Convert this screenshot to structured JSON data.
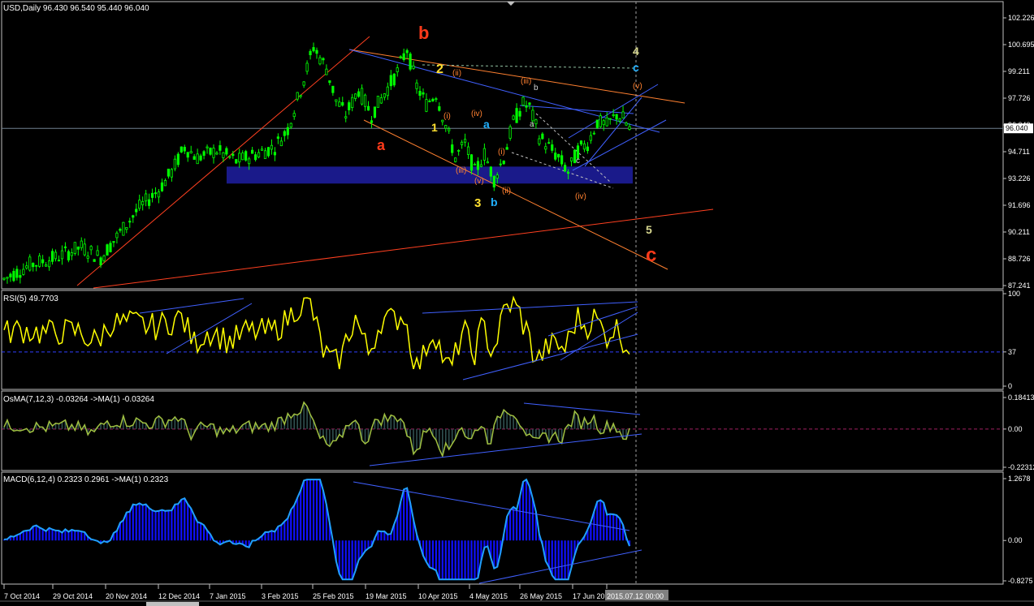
{
  "chart_data": [
    {
      "type": "candlestick",
      "symbol_label": "USD,Daily  96.430 96.540 95.440 96.040",
      "ylim": [
        87.241,
        102.226
      ],
      "y_ticks": [
        "102.226",
        "100.695",
        "99.211",
        "97.726",
        "96.040",
        "94.711",
        "93.226",
        "91.696",
        "90.211",
        "88.726",
        "87.241"
      ],
      "current_price": "96.040",
      "x_ticks": [
        "7 Oct 2014",
        "29 Oct 2014",
        "20 Nov 2014",
        "12 Dec 2014",
        "7 Jan 2015",
        "3 Feb 2015",
        "25 Feb 2015",
        "19 Mar 2015",
        "10 Apr 2015",
        "4 May 2015",
        "26 May 2015",
        "17 Jun 20",
        "2015.07.12 00:00"
      ],
      "wave_labels": [
        {
          "text": "b",
          "color": "#ff3a1a"
        },
        {
          "text": "a",
          "color": "#ff3a1a"
        },
        {
          "text": "c",
          "color": "#ff3a1a"
        },
        {
          "text": "2",
          "color": "#ffe030"
        },
        {
          "text": "1",
          "color": "#ffe030"
        },
        {
          "text": "3",
          "color": "#ffe030"
        },
        {
          "text": "4",
          "color": "#d8d890"
        },
        {
          "text": "5",
          "color": "#d8d890"
        },
        {
          "text": "c",
          "color": "#20b0ff"
        },
        {
          "text": "a",
          "color": "#20b0ff"
        },
        {
          "text": "b",
          "color": "#20b0ff"
        },
        {
          "text": "(ii)",
          "color": "#ff8030"
        },
        {
          "text": "(i)",
          "color": "#ff8030"
        },
        {
          "text": "(iv)",
          "color": "#ff8030"
        },
        {
          "text": "(iii)",
          "color": "#ff8030"
        },
        {
          "text": "(v)",
          "color": "#ff8030"
        },
        {
          "text": "(i)",
          "color": "#ff8030"
        },
        {
          "text": "(ii)",
          "color": "#ff8030"
        },
        {
          "text": "(iii)",
          "color": "#ff8030"
        },
        {
          "text": "(iv)",
          "color": "#ff8030"
        },
        {
          "text": "(v)",
          "color": "#ff8030"
        },
        {
          "text": "b",
          "color": "#d0d0d0"
        },
        {
          "text": "a",
          "color": "#d0d0d0"
        },
        {
          "text": "c",
          "color": "#d0d0d0"
        }
      ]
    },
    {
      "type": "line",
      "label": "RSI(5) 49.7703",
      "y_ticks": [
        "100",
        "37",
        "0"
      ],
      "ylim": [
        0,
        100
      ],
      "level": 37,
      "color": "#ffff00"
    },
    {
      "type": "histogram",
      "label": "OsMA(7,12,3) -0.03264  ->MA(1) -0.03264",
      "y_ticks": [
        "0.18413",
        "0.00",
        "-0.22312"
      ],
      "ylim": [
        -0.22312,
        0.18413
      ],
      "color": "#a0c040"
    },
    {
      "type": "histogram",
      "label": "MACD(6,12,4) 0.2323 0.2961  ->MA(1) 0.2323",
      "y_ticks": [
        "1.2678",
        "0.00",
        "-0.8275"
      ],
      "ylim": [
        -0.8275,
        1.2678
      ],
      "color": "#20a0ff",
      "bar_color": "#1010ff"
    }
  ]
}
